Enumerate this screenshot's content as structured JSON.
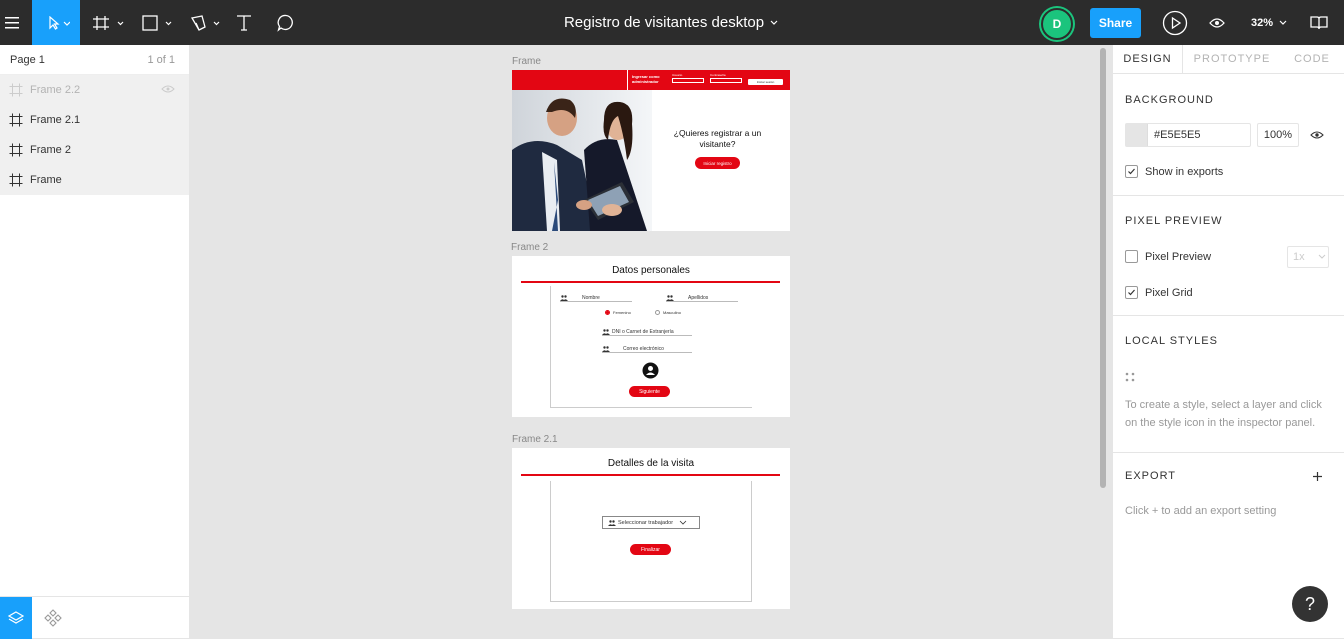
{
  "toolbar": {
    "menu_icon": "hamburger-icon",
    "tools": [
      {
        "name": "move",
        "icon": "cursor-icon"
      },
      {
        "name": "frame",
        "icon": "frame-icon"
      },
      {
        "name": "shape",
        "icon": "rectangle-icon"
      },
      {
        "name": "pen",
        "icon": "pen-icon"
      },
      {
        "name": "text",
        "icon": "text-icon"
      },
      {
        "name": "comment",
        "icon": "comment-icon"
      }
    ],
    "document_title": "Registro de visitantes desktop",
    "avatar_initial": "D",
    "share_label": "Share",
    "zoom_label": "32%"
  },
  "left_panel": {
    "page_label": "Page 1",
    "page_count": "1 of 1",
    "layers": [
      {
        "name": "Frame 2.2",
        "hidden": true
      },
      {
        "name": "Frame 2.1",
        "hidden": false
      },
      {
        "name": "Frame 2",
        "hidden": false
      },
      {
        "name": "Frame",
        "hidden": false
      }
    ]
  },
  "canvas": {
    "frame1": {
      "label": "Frame",
      "header_admin": "Ingresar como administrador",
      "field1_label": "Usuario",
      "field2_label": "Contraseña",
      "login_button": "Iniciar sesión",
      "question": "¿Quieres registrar a un visitante?",
      "cta_button": "Iniciar registro"
    },
    "frame2": {
      "label": "Frame 2",
      "title": "Datos personales",
      "field_nombre": "Nombre",
      "field_apellidos": "Apellidos",
      "radio_femenino": "Femenino",
      "radio_masculino": "Masculino",
      "field_dni": "DNI o Carnet de Extranjería",
      "field_correo": "Correo electrónico",
      "next_button": "Siguiente"
    },
    "frame3": {
      "label": "Frame 2.1",
      "title": "Detalles de la visita",
      "select_placeholder": "Seleccionar trabajador",
      "finish_button": "Finalizar"
    }
  },
  "right_panel": {
    "tabs": [
      "DESIGN",
      "PROTOTYPE",
      "CODE"
    ],
    "background_title": "BACKGROUND",
    "bg_hex": "#E5E5E5",
    "bg_opacity": "100%",
    "show_in_exports": "Show in exports",
    "pixel_preview_title": "PIXEL PREVIEW",
    "pixel_preview_label": "Pixel Preview",
    "pixel_preview_scale": "1x",
    "pixel_grid_label": "Pixel Grid",
    "local_styles_title": "LOCAL STYLES",
    "local_styles_hint": "To create a style, select a layer and click on the style icon in the inspector panel.",
    "export_title": "EXPORT",
    "export_hint": "Click + to add an export setting",
    "help_label": "?"
  },
  "colors": {
    "accent": "#18a0fb",
    "toolbar_bg": "#2c2c2c",
    "brand_red": "#e30613",
    "avatar_green": "#1bc47d"
  }
}
